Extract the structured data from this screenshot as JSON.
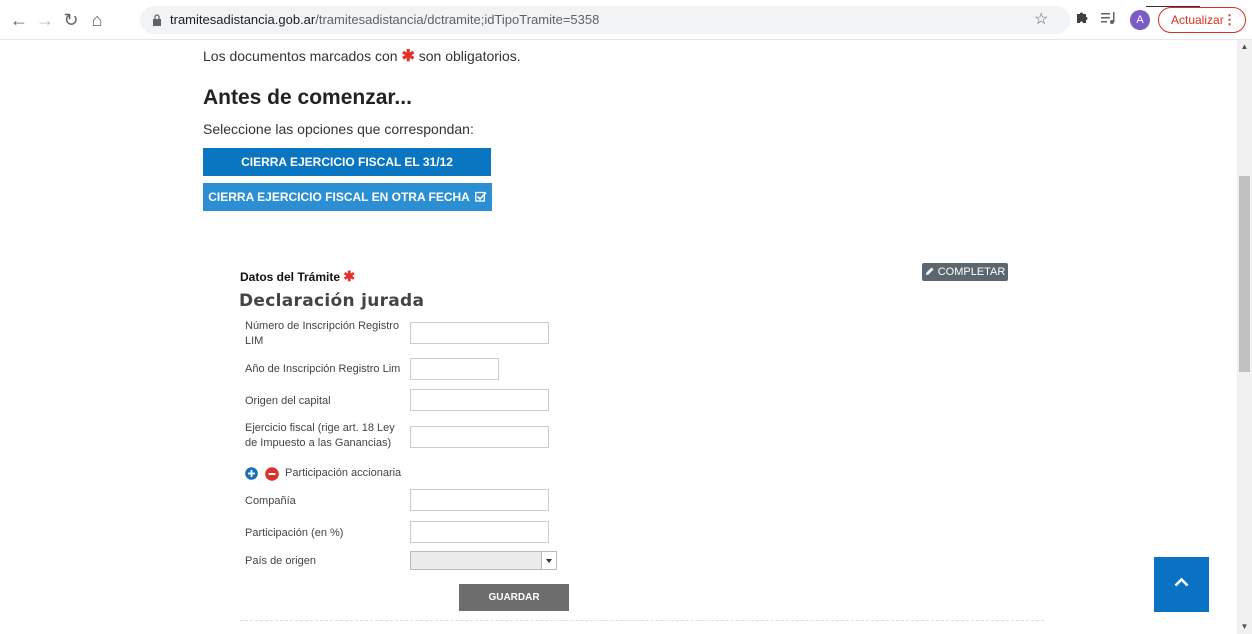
{
  "browser": {
    "url_host": "tramitesadistancia.gob.ar",
    "url_path": "/tramitesadistancia/dctramite;idTipoTramite=5358",
    "avatar_letter": "A",
    "update_label": "Actualizar",
    "menu_dots": "⋮"
  },
  "page": {
    "notice_prefix": "Los documentos marcados con",
    "notice_suffix": "son obligatorios.",
    "req_star": "✱",
    "title": "Antes de comenzar...",
    "select_prompt": "Seleccione las opciones que correspondan:",
    "options": [
      {
        "label": "CIERRA EJERCICIO FISCAL EL 31/12"
      },
      {
        "label": "CIERRA EJERCICIO FISCAL EN OTRA FECHA"
      }
    ]
  },
  "form": {
    "section_title": "Datos del Trámite",
    "complete_label": "COMPLETAR",
    "subtitle": "Declaración jurada",
    "fields": [
      {
        "label": "Número de Inscripción Registro LIM",
        "value": ""
      },
      {
        "label": "Año de Inscripción Registro Lim",
        "value": ""
      },
      {
        "label": "Origen del capital",
        "value": ""
      },
      {
        "label": "Ejercicio fiscal (rige art. 18 Ley de Impuesto a las Ganancias)",
        "value": ""
      }
    ],
    "participation_label": "Participación accionaria",
    "sub_fields": [
      {
        "label": "Compañía",
        "value": ""
      },
      {
        "label": "Participación (en %)",
        "value": ""
      },
      {
        "label": "País de origen",
        "value": ""
      }
    ],
    "save_label": "GUARDAR"
  },
  "colors": {
    "primary_blue": "#0a75c0",
    "required_red": "#e5302c",
    "update_red": "#d93025"
  }
}
